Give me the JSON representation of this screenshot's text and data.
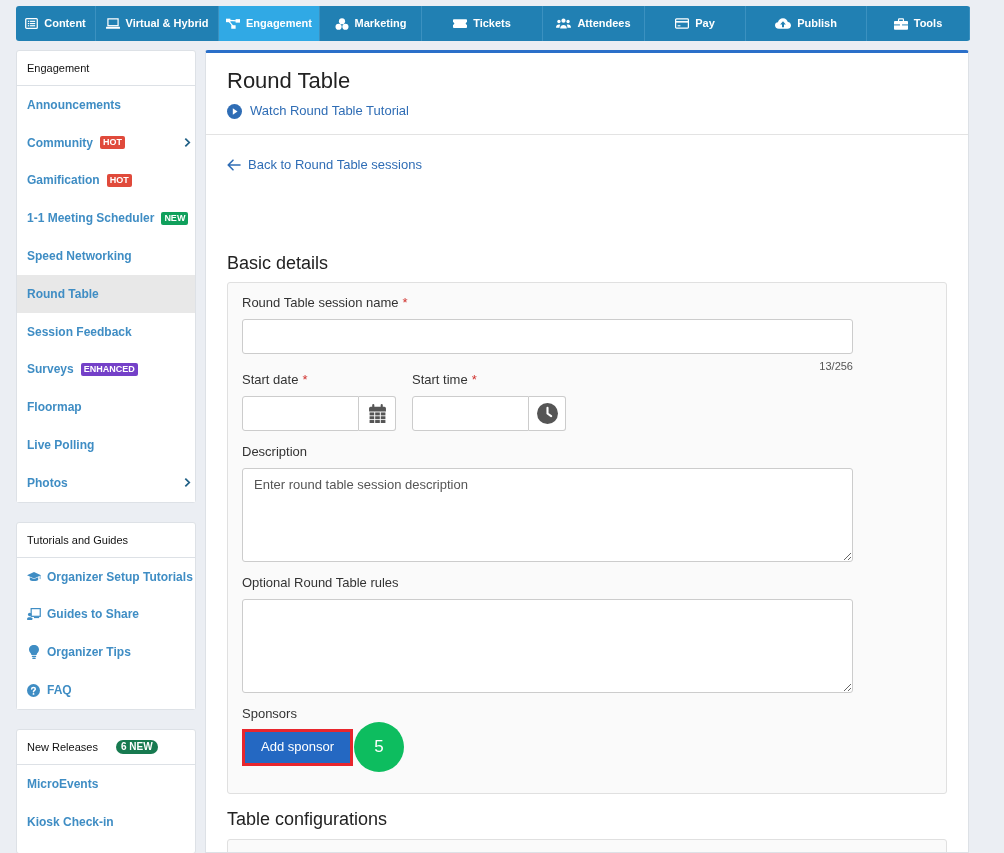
{
  "top_nav": {
    "tabs": [
      {
        "label": "Content",
        "selected": false
      },
      {
        "label": "Virtual & Hybrid",
        "selected": false
      },
      {
        "label": "Engagement",
        "selected": true
      },
      {
        "label": "Marketing",
        "selected": false
      },
      {
        "label": "Tickets",
        "selected": false
      },
      {
        "label": "Attendees",
        "selected": false
      },
      {
        "label": "Pay",
        "selected": false
      },
      {
        "label": "Publish",
        "selected": false
      },
      {
        "label": "Tools",
        "selected": false
      }
    ]
  },
  "sidebar": {
    "sections": [
      {
        "kind": "menu",
        "title": "Engagement",
        "items": [
          {
            "label": "Announcements",
            "selected": false,
            "expandable": false
          },
          {
            "label": "Community",
            "selected": false,
            "expandable": true,
            "badge": {
              "text": "HOT",
              "color": "#e04a3b"
            }
          },
          {
            "label": "Gamification",
            "selected": false,
            "expandable": false,
            "badge": {
              "text": "HOT",
              "color": "#e04a3b"
            }
          },
          {
            "label": "1-1 Meeting Scheduler",
            "selected": false,
            "expandable": false,
            "badge": {
              "text": "NEW",
              "color": "#10a05c"
            }
          },
          {
            "label": "Speed Networking",
            "selected": false,
            "expandable": false
          },
          {
            "label": "Round Table",
            "selected": true,
            "expandable": false
          },
          {
            "label": "Session Feedback",
            "selected": false,
            "expandable": false
          },
          {
            "label": "Surveys",
            "selected": false,
            "expandable": false,
            "badge": {
              "text": "ENHANCED",
              "color": "#7440c8"
            }
          },
          {
            "label": "Floormap",
            "selected": false,
            "expandable": false
          },
          {
            "label": "Live Polling",
            "selected": false,
            "expandable": false
          },
          {
            "label": "Photos",
            "selected": false,
            "expandable": true
          }
        ]
      },
      {
        "kind": "guides",
        "title": "Tutorials and Guides",
        "items": [
          {
            "label": "Organizer Setup Tutorials",
            "selected": false
          },
          {
            "label": "Guides to Share",
            "selected": false
          },
          {
            "label": "Organizer Tips",
            "selected": false
          },
          {
            "label": "FAQ",
            "selected": false
          }
        ]
      },
      {
        "kind": "menu",
        "title": "New Releases",
        "badge": {
          "text": "6 NEW",
          "color": "#177a50"
        },
        "items": [
          {
            "label": "MicroEvents",
            "selected": false
          },
          {
            "label": "Kiosk Check-in",
            "selected": false
          }
        ]
      }
    ]
  },
  "main": {
    "title": "Round Table",
    "tutorial_link": "Watch Round Table Tutorial",
    "back_link": "Back to Round Table sessions",
    "sections": [
      {
        "heading": "Basic details",
        "fields": [
          {
            "kind": "text",
            "label": "Round Table session name",
            "required_mark": "*",
            "counter": "13/256"
          },
          {
            "kind": "row",
            "fields": [
              {
                "kind": "date",
                "label": "Start date",
                "required_mark": "*"
              },
              {
                "kind": "time",
                "label": "Start time",
                "required_mark": "*"
              }
            ]
          },
          {
            "kind": "textarea",
            "label": "Description",
            "placeholder": "Enter round table session description"
          },
          {
            "kind": "textarea",
            "label": "Optional Round Table rules"
          },
          {
            "kind": "button",
            "label": "Sponsors",
            "button": "Add sponsor",
            "highlighted": true,
            "step_marker": "5"
          }
        ]
      },
      {
        "heading": "Table configurations"
      }
    ]
  }
}
